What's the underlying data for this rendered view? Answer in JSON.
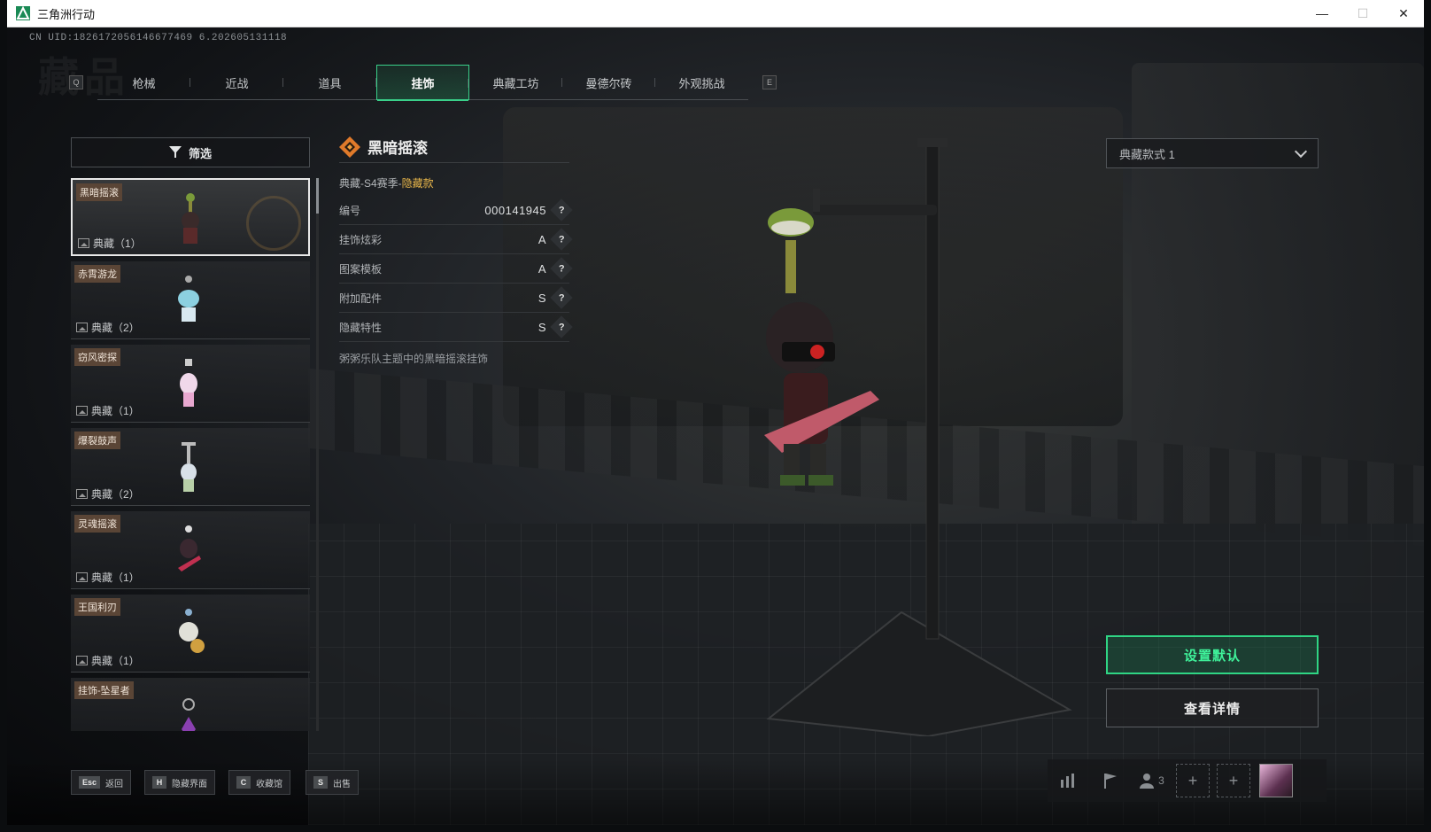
{
  "window": {
    "title": "三角洲行动",
    "minimize": "—",
    "maximize": "☐",
    "close": "✕"
  },
  "uid": "CN UID:1826172056146677469 6.202605131118",
  "tabs": {
    "left_key": "Q",
    "right_key": "E",
    "items": [
      {
        "label": "枪械",
        "active": false
      },
      {
        "label": "近战",
        "active": false
      },
      {
        "label": "道具",
        "active": false
      },
      {
        "label": "挂饰",
        "active": true
      },
      {
        "label": "典藏工坊",
        "active": false
      },
      {
        "label": "曼德尔砖",
        "active": false
      },
      {
        "label": "外观挑战",
        "active": false
      }
    ]
  },
  "filter": {
    "label": "筛选"
  },
  "items": [
    {
      "name": "黑暗摇滚",
      "count": "典藏（1）",
      "selected": true
    },
    {
      "name": "赤霄游龙",
      "count": "典藏（2）",
      "selected": false
    },
    {
      "name": "窃风密探",
      "count": "典藏（1）",
      "selected": false
    },
    {
      "name": "爆裂鼓声",
      "count": "典藏（2）",
      "selected": false
    },
    {
      "name": "灵魂摇滚",
      "count": "典藏（1）",
      "selected": false
    },
    {
      "name": "王国利刃",
      "count": "典藏（1）",
      "selected": false
    },
    {
      "name": "挂饰-坠星者",
      "count": "",
      "selected": false
    }
  ],
  "detail": {
    "title": "黑暗摇滚",
    "sub_prefix": "典藏-S4赛季-",
    "sub_highlight": "隐藏款",
    "attrs": [
      {
        "label": "编号",
        "value": "000141945"
      },
      {
        "label": "挂饰炫彩",
        "value": "A"
      },
      {
        "label": "图案模板",
        "value": "A"
      },
      {
        "label": "附加配件",
        "value": "S"
      },
      {
        "label": "隐藏特性",
        "value": "S"
      }
    ],
    "help": "?",
    "description": "粥粥乐队主题中的黑暗摇滚挂饰"
  },
  "variant": {
    "selected": "典藏款式 1"
  },
  "actions": {
    "set_default": "设置默认",
    "view_detail": "查看详情"
  },
  "hints": [
    {
      "key": "Esc",
      "label": "返回"
    },
    {
      "key": "H",
      "label": "隐藏界面"
    },
    {
      "key": "C",
      "label": "收藏馆"
    },
    {
      "key": "S",
      "label": "出售"
    }
  ],
  "tray": {
    "party_count": "3",
    "plus": "+"
  },
  "colors": {
    "accent": "#3ad08a",
    "highlight": "#e8b64a",
    "tag": "#5a4536"
  }
}
